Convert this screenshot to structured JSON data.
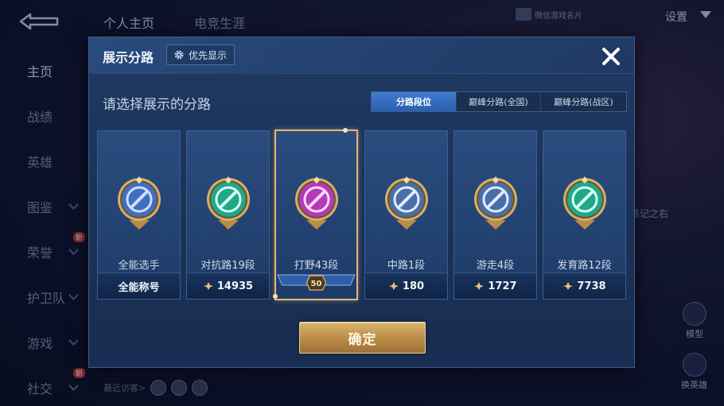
{
  "top_tabs": [
    "个人主页",
    "电竞生涯"
  ],
  "side_nav": [
    {
      "label": "主页",
      "active": true,
      "chevron": false,
      "new": false
    },
    {
      "label": "战绩",
      "active": false,
      "chevron": false,
      "new": false
    },
    {
      "label": "英雄",
      "active": false,
      "chevron": false,
      "new": false
    },
    {
      "label": "图鉴",
      "active": false,
      "chevron": true,
      "new": false
    },
    {
      "label": "荣誉",
      "active": false,
      "chevron": true,
      "new": true
    },
    {
      "label": "护卫队",
      "active": false,
      "chevron": true,
      "new": false
    },
    {
      "label": "游戏",
      "active": false,
      "chevron": true,
      "new": false
    },
    {
      "label": "社交",
      "active": false,
      "chevron": true,
      "new": true
    }
  ],
  "new_badge": "新",
  "top_right": {
    "wechat_card": "微信游戏名片",
    "settings": "设置"
  },
  "bg_text": "该记之右",
  "visitors_label": "最近访客>",
  "right_buttons": [
    "模型",
    "换英雄"
  ],
  "modal": {
    "title": "展示分路",
    "priority_label": "优先显示",
    "subtitle": "请选择展示的分路",
    "tabs": [
      {
        "label": "分路段位",
        "active": true
      },
      {
        "label": "巅峰分路(全国)",
        "active": false
      },
      {
        "label": "巅峰分路(战区)",
        "active": false
      }
    ],
    "cards": [
      {
        "name": "全能选手",
        "stat": "全能称号",
        "star": false,
        "selected": false,
        "color": "#3f6fc2",
        "accent": "#cfe0ff"
      },
      {
        "name": "对抗路19段",
        "stat": "14935",
        "star": true,
        "selected": false,
        "color": "#1fa88a",
        "accent": "#d9fff3"
      },
      {
        "name": "打野43段",
        "stat": "",
        "star": false,
        "selected": true,
        "level": "50",
        "color": "#b43ab8",
        "accent": "#ffd9ff"
      },
      {
        "name": "中路1段",
        "stat": "180",
        "star": true,
        "selected": false,
        "color": "#4a6fa8",
        "accent": "#e2ecff"
      },
      {
        "name": "游走4段",
        "stat": "1727",
        "star": true,
        "selected": false,
        "color": "#4a6fa8",
        "accent": "#e2ecff"
      },
      {
        "name": "发育路12段",
        "stat": "7738",
        "star": true,
        "selected": false,
        "color": "#1fa88a",
        "accent": "#d9fff3"
      }
    ],
    "confirm_label": "确定"
  },
  "colors": {
    "gold": "#e0b877",
    "tab_active": "#3f7bd0",
    "modal_bg": "#1f3a63"
  }
}
